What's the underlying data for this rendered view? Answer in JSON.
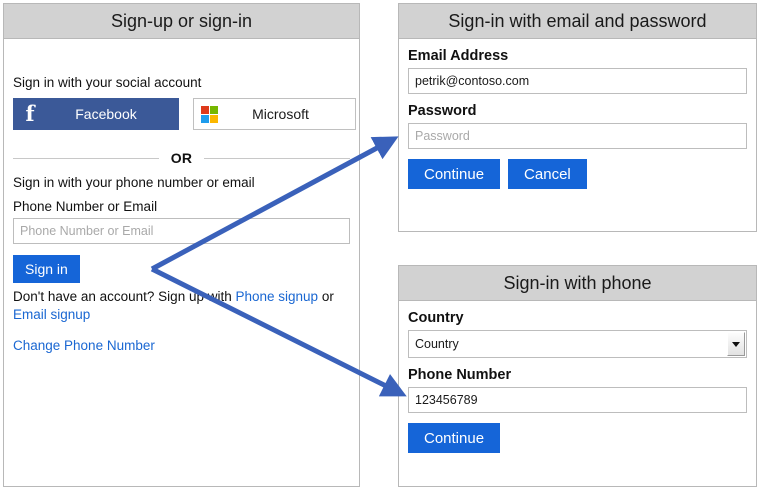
{
  "signup_card": {
    "title": "Sign-up or sign-in",
    "social_prompt": "Sign in with your social account",
    "facebook_label": "Facebook",
    "facebook_glyph": "f",
    "microsoft_label": "Microsoft",
    "or_text": "OR",
    "phone_prompt": "Sign in with your phone number or email",
    "identifier_label": "Phone Number or Email",
    "identifier_placeholder": "Phone Number or Email",
    "identifier_value": "",
    "signin_button": "Sign in",
    "signup_text_before": "Don't have an account? Sign up with ",
    "phone_signup_link": "Phone signup",
    "signup_text_or": " or ",
    "email_signup_link": "Email signup",
    "change_phone_link": "Change Phone Number"
  },
  "email_card": {
    "title": "Sign-in with email and password",
    "email_label": "Email Address",
    "email_value": "petrik@contoso.com",
    "email_placeholder": "Email Address",
    "password_label": "Password",
    "password_placeholder": "Password",
    "password_value": "",
    "continue_button": "Continue",
    "cancel_button": "Cancel"
  },
  "phone_card": {
    "title": "Sign-in with phone",
    "country_label": "Country",
    "country_value": "Country",
    "phone_label": "Phone Number",
    "phone_value": "123456789",
    "phone_placeholder": "Phone Number",
    "continue_button": "Continue"
  },
  "colors": {
    "header_gray": "#d2d2d2",
    "facebook_blue": "#3b5998",
    "primary_blue": "#1565d8",
    "link_blue": "#1a67d2",
    "arrow_blue": "#3a61ba",
    "ms_red": "#de3a1b",
    "ms_green": "#76b700",
    "ms_blue": "#1e9ced",
    "ms_yellow": "#fbb700"
  }
}
